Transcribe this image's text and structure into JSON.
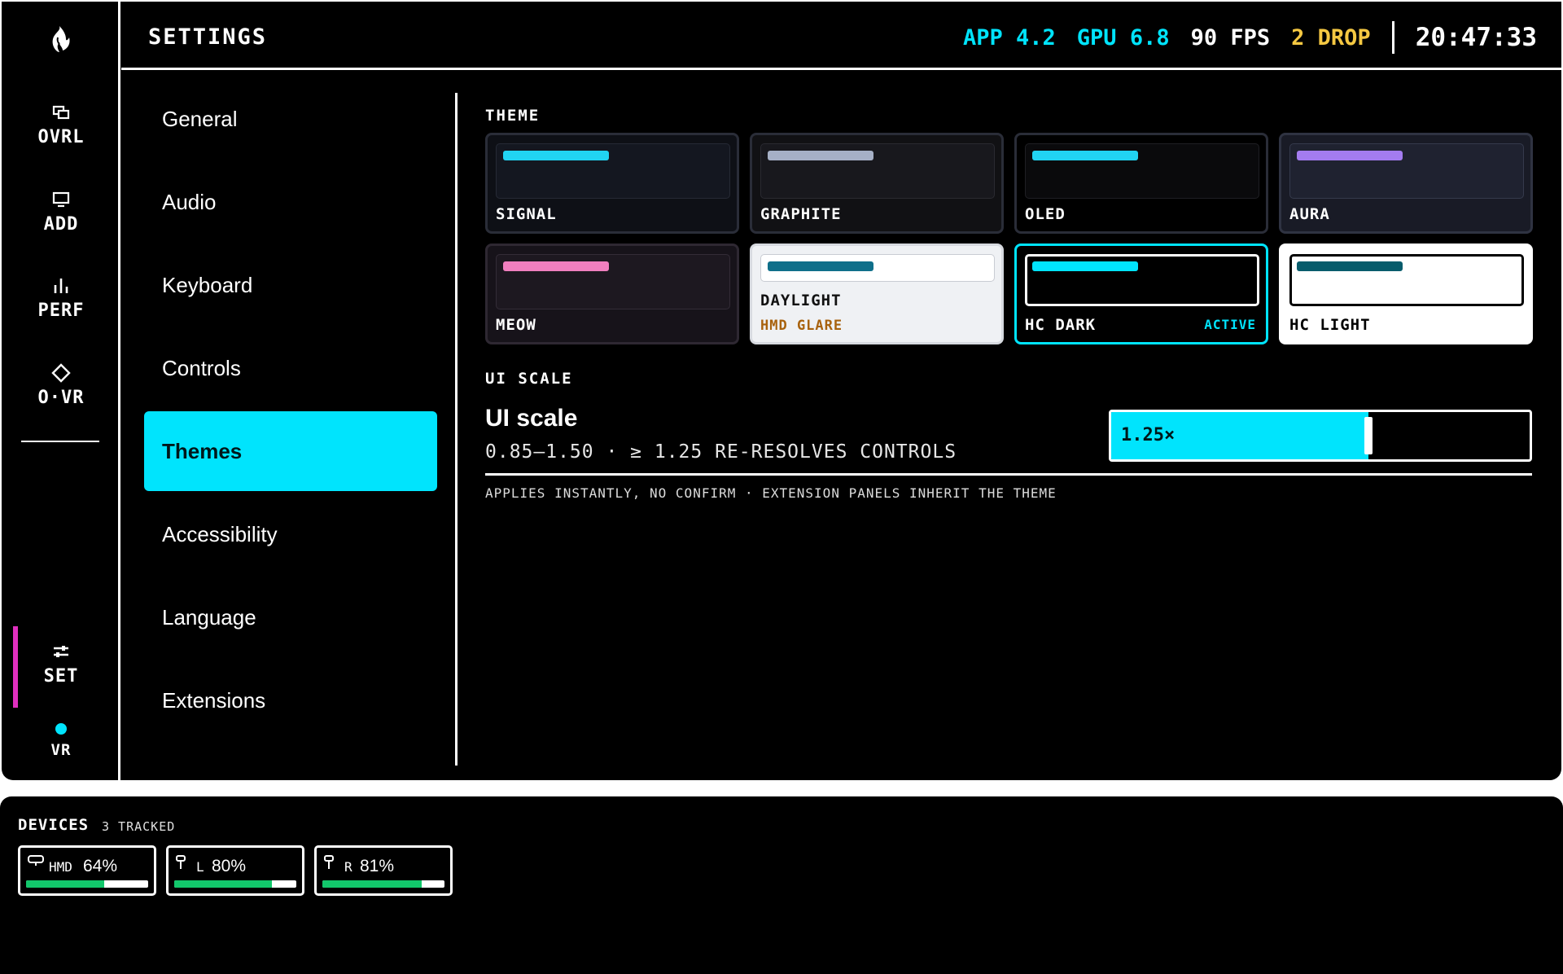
{
  "header": {
    "title": "SETTINGS",
    "stats": {
      "app": "APP 4.2",
      "gpu": "GPU 6.8",
      "fps": "90 FPS",
      "drop": "2 DROP"
    },
    "clock": "20:47:33"
  },
  "rail": {
    "items": [
      {
        "label": "OVRL",
        "icon": "overlay-icon"
      },
      {
        "label": "ADD",
        "icon": "monitor-icon"
      },
      {
        "label": "PERF",
        "icon": "bar-chart-icon"
      },
      {
        "label": "O·VR",
        "icon": "diamond-icon"
      },
      {
        "label": "SET",
        "icon": "sliders-icon"
      },
      {
        "label": "VR",
        "icon": "status-dot-icon"
      }
    ],
    "active": "SET"
  },
  "nav": {
    "items": [
      "General",
      "Audio",
      "Keyboard",
      "Controls",
      "Themes",
      "Accessibility",
      "Language",
      "Extensions"
    ],
    "active": "Themes"
  },
  "theme_section": {
    "label": "THEME",
    "themes": [
      {
        "name": "SIGNAL"
      },
      {
        "name": "GRAPHITE"
      },
      {
        "name": "OLED"
      },
      {
        "name": "AURA"
      },
      {
        "name": "MEOW"
      },
      {
        "name": "DAYLIGHT",
        "sub": "HMD GLARE"
      },
      {
        "name": "HC DARK",
        "badge": "ACTIVE"
      },
      {
        "name": "HC LIGHT"
      }
    ]
  },
  "ui_scale": {
    "section_label": "UI SCALE",
    "title": "UI scale",
    "range_text": "0.85–1.50 · ≥ 1.25 RE-RESOLVES CONTROLS",
    "value_label": "1.25×",
    "value": 1.25,
    "min": 0.85,
    "max": 1.5,
    "note": "APPLIES INSTANTLY, NO CONFIRM · EXTENSION PANELS INHERIT THE THEME"
  },
  "devices": {
    "title": "DEVICES",
    "count": "3 TRACKED",
    "items": [
      {
        "name": "HMD",
        "battery": "64%",
        "level": 64,
        "icon": "headset-icon"
      },
      {
        "name": "L",
        "battery": "80%",
        "level": 80,
        "icon": "controller-icon"
      },
      {
        "name": "R",
        "battery": "81%",
        "level": 81,
        "icon": "controller-icon"
      }
    ]
  },
  "colors": {
    "accent": "#00e4fd",
    "warning": "#f5c842",
    "active_marker": "#e02fbf",
    "battery": "#12c76b",
    "daylight_sub": "#a8620e"
  }
}
